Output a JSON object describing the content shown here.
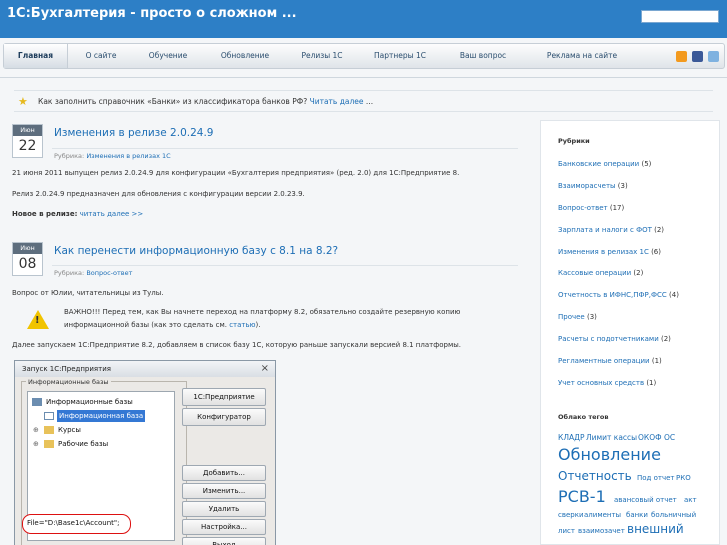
{
  "header": {
    "title": "1С:Бухгалтерия - просто о сложном ..."
  },
  "nav": {
    "items": [
      "Главная",
      "О сайте",
      "Обучение",
      "Обновление",
      "Релизы 1С",
      "Партнеры 1С",
      "Ваш вопрос",
      "Реклама на сайте"
    ]
  },
  "notice": {
    "text": "Как заполнить справочник «Банки» из классификатора банков РФ?",
    "link": "Читать далее",
    "suffix": " ..."
  },
  "posts": [
    {
      "month": "Июн",
      "day": "22",
      "title": "Изменения в релизе 2.0.24.9",
      "meta_label": "Рубрика:",
      "meta_link": "Изменения в релизах 1С",
      "p1": "21 июня 2011 выпущен релиз 2.0.24.9 для конфигурации «Бухгалтерия предприятия» (ред. 2.0) для 1С:Предприятие 8.",
      "p2": "Релиз 2.0.24.9 предназначен для обновления с конфигурации версии 2.0.23.9.",
      "p3_bold": "Новое в релизе:",
      "p3_link": "читать далее >>"
    },
    {
      "month": "Июн",
      "day": "08",
      "title": "Как перенести информационную базу с 8.1 на 8.2?",
      "meta_label": "Рубрика:",
      "meta_link": "Вопрос-ответ",
      "p1": "Вопрос от Юлии, читательницы из Тулы.",
      "warn1": "ВАЖНО!!! Перед тем, как Вы начнете переход на платформу 8.2, обязательно создайте резервную копию",
      "warn2": "информационной базы (как это сделать см.",
      "warn2_link": "статью",
      "warn2_end": ").",
      "p2": "Далее запускаем 1С:Предприятие 8.2, добавляем в список базу 1С, которую раньше запускали версией 8.1 платформы."
    }
  ],
  "dialog": {
    "title": "Запуск 1С:Предприятия",
    "close": "×",
    "group_label": "Информационные базы",
    "tree": [
      "Информационные базы",
      "Информационная база",
      "Курсы",
      "Рабочие базы"
    ],
    "buttons": [
      "1С:Предприятие",
      "Конфигуратор",
      "Добавить...",
      "Изменить...",
      "Удалить",
      "Настройка...",
      "Выход"
    ],
    "path": "File=\"D:\\Base1c\\Account\";"
  },
  "sidebar": {
    "categories_heading": "Рубрики",
    "categories": [
      {
        "name": "Банковские операции",
        "count": "(5)"
      },
      {
        "name": "Взаиморасчеты",
        "count": "(3)"
      },
      {
        "name": "Вопрос-ответ",
        "count": "(17)"
      },
      {
        "name": "Зарплата и налоги с ФОТ",
        "count": "(2)"
      },
      {
        "name": "Изменения в релизах 1С",
        "count": "(6)"
      },
      {
        "name": "Кассовые операции",
        "count": "(2)"
      },
      {
        "name": "Отчетность в ИФНС,ПФР,ФСС",
        "count": "(4)"
      },
      {
        "name": "Прочее",
        "count": "(3)"
      },
      {
        "name": "Расчеты с подотчетниками",
        "count": "(2)"
      },
      {
        "name": "Регламентные операции",
        "count": "(1)"
      },
      {
        "name": "Учет основных средств",
        "count": "(1)"
      }
    ],
    "tags_heading": "Облако тегов",
    "tags": [
      "КЛАДР",
      "Лимит кассы",
      "ОКОФ",
      "ОС",
      "Обновление",
      "Отчетность",
      "Под отчет",
      "РКО",
      "РСВ-1",
      "авансовый отчет",
      "акт",
      "сверки",
      "алименты",
      "банки",
      "больничный",
      "лист",
      "взаимозачет",
      "внешний"
    ]
  },
  "colors": {
    "header_bg": "#2d7fc6",
    "link": "#1d6eb5",
    "warning": "#f1c400",
    "selection": "#3478d4"
  }
}
